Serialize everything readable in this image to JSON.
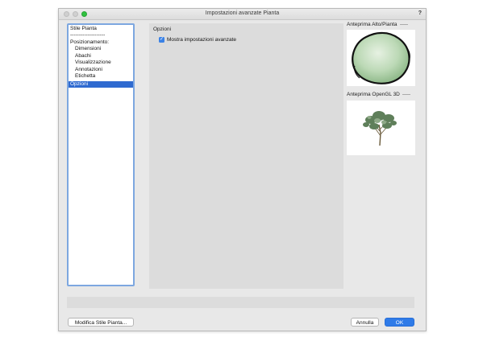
{
  "window": {
    "title": "Impostazioni avanzate Pianta",
    "help_label": "?"
  },
  "sidebar": {
    "items": [
      {
        "label": "Stile Pianta",
        "level": "top",
        "selected": false
      },
      {
        "label": "--------------------",
        "level": "top",
        "selected": false
      },
      {
        "label": "Posizionamento:",
        "level": "top",
        "selected": false
      },
      {
        "label": "Dimensioni",
        "level": "indent",
        "selected": false
      },
      {
        "label": "Abachi",
        "level": "indent",
        "selected": false
      },
      {
        "label": "Visualizzazione",
        "level": "indent",
        "selected": false
      },
      {
        "label": "Annotazioni",
        "level": "indent",
        "selected": false
      },
      {
        "label": "Etichetta",
        "level": "indent",
        "selected": false
      },
      {
        "label": "Opzioni",
        "level": "top",
        "selected": true
      }
    ]
  },
  "main": {
    "section_label": "Opzioni",
    "checkbox": {
      "label": "Mostra impostazioni avanzate",
      "checked": true,
      "check_glyph": "✓"
    }
  },
  "previews": {
    "top_label": "Anteprima Alto/Pianta",
    "opengl_label": "Anteprima OpenGL 3D"
  },
  "buttons": {
    "edit_style": "Modifica Stile Pianta...",
    "cancel": "Annulla",
    "ok": "OK"
  },
  "colors": {
    "accent": "#2f7be8",
    "selection": "#2f6ad0",
    "sidebar_border": "#7da7e0"
  }
}
